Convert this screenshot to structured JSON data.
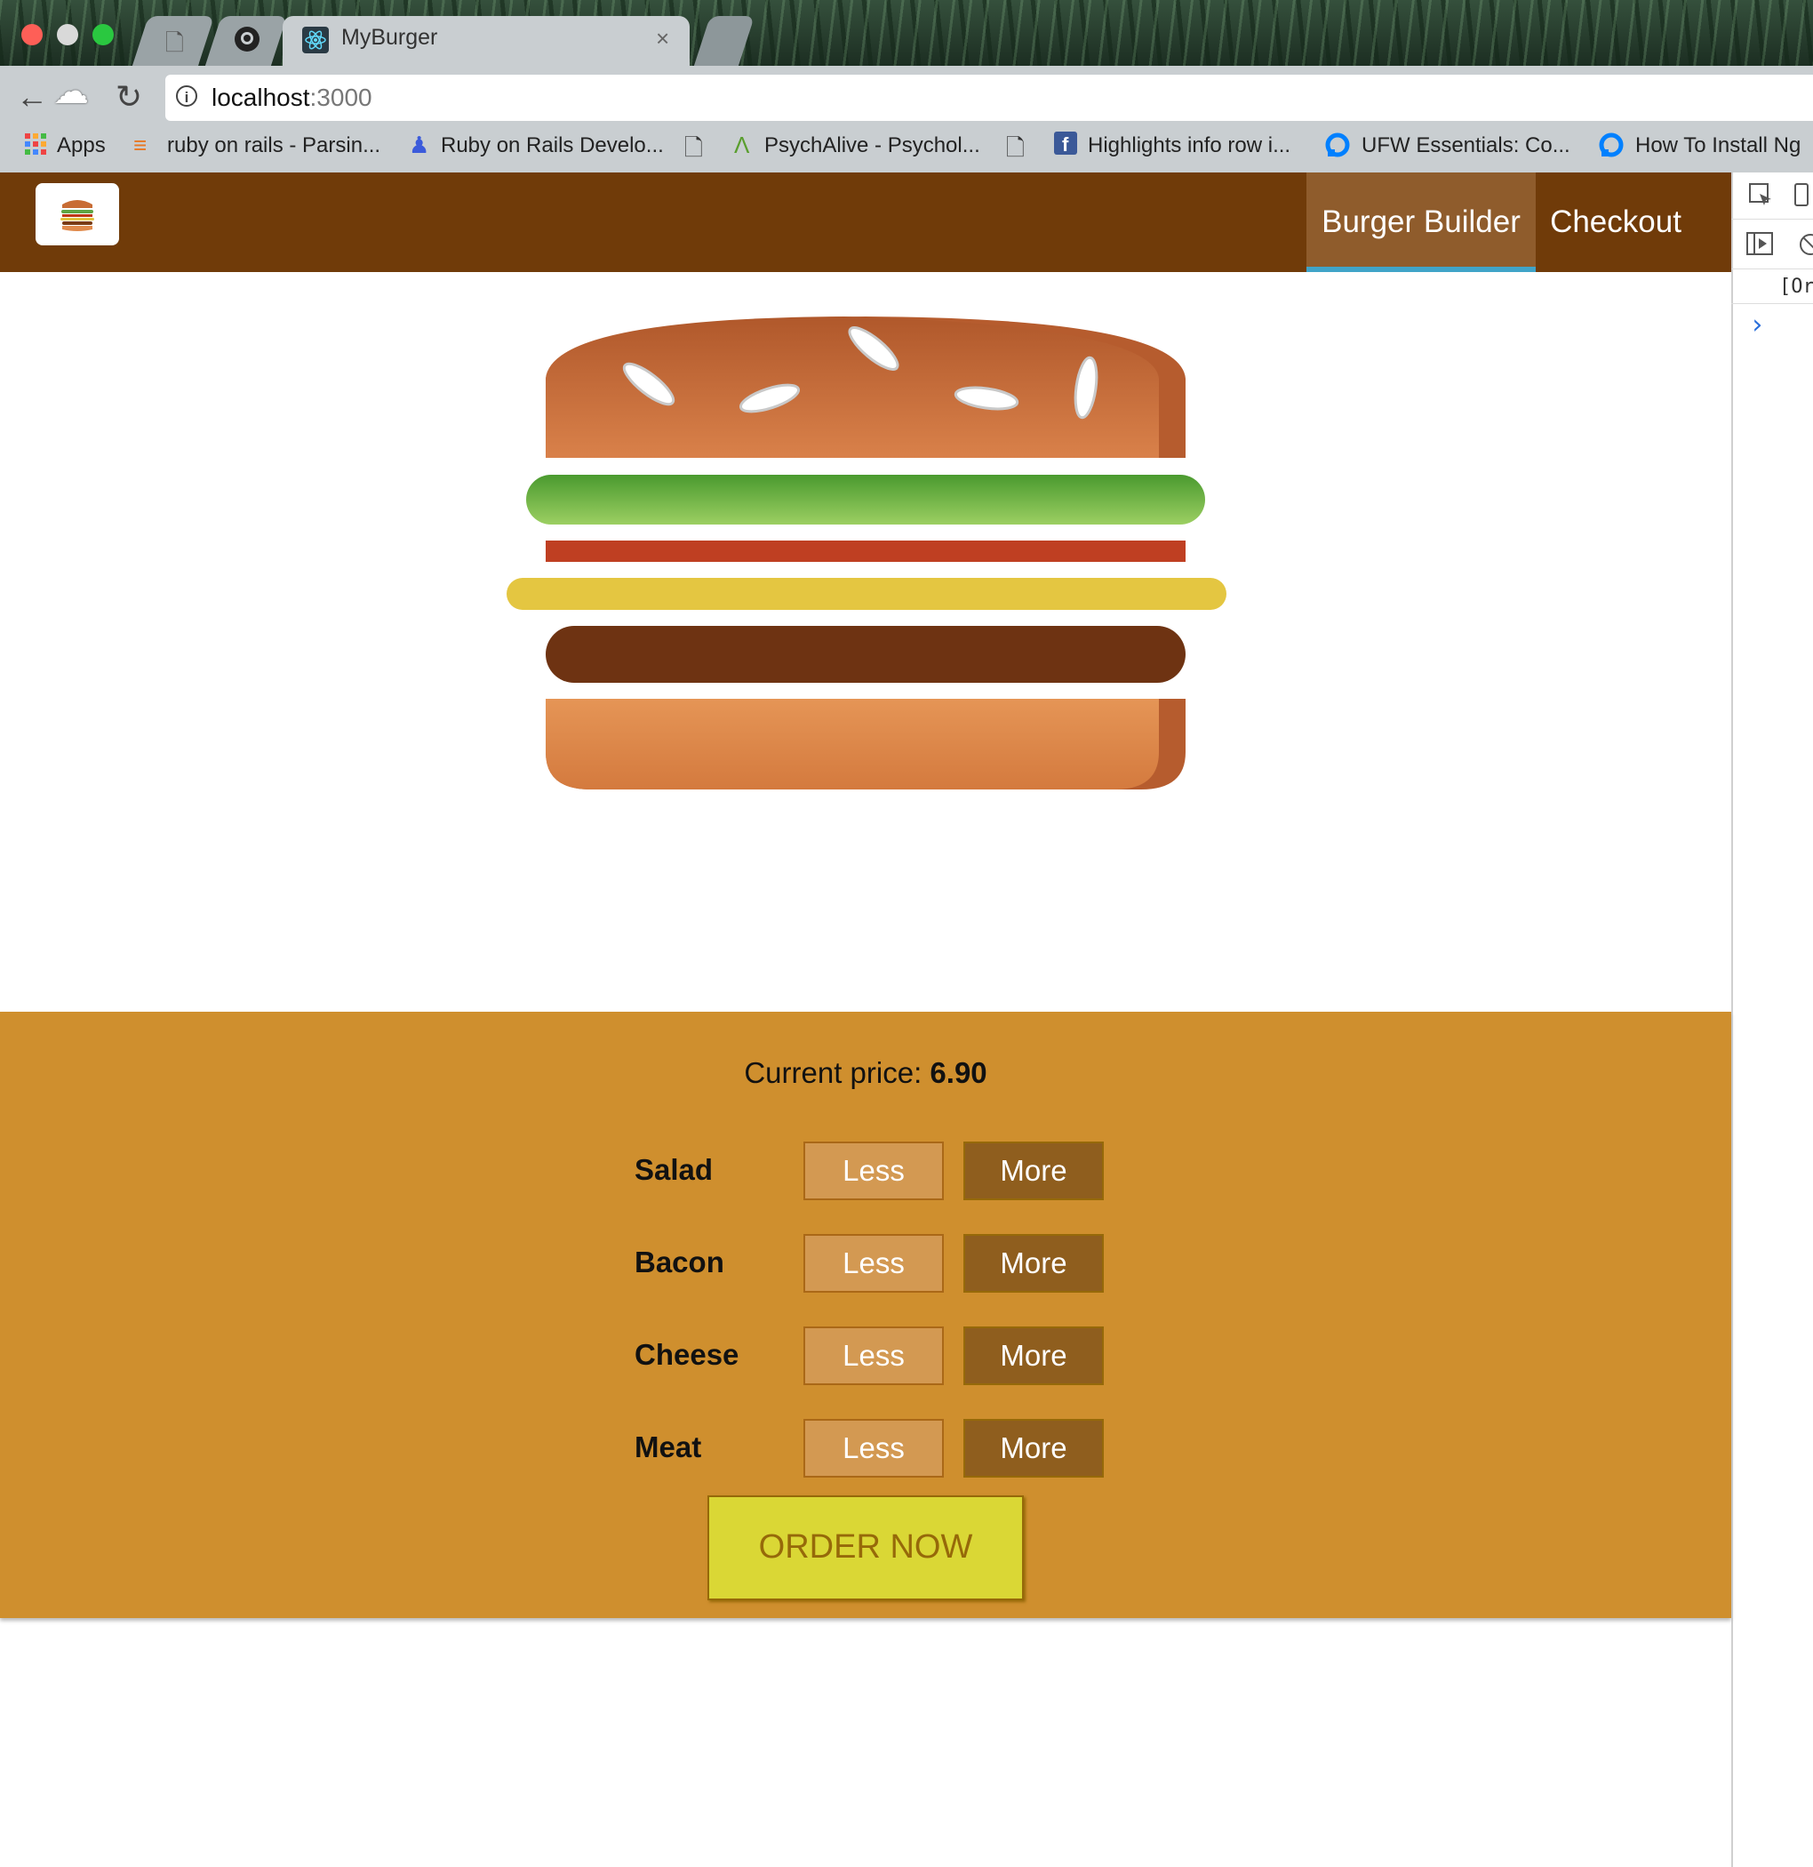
{
  "browser": {
    "tab_title": "MyBurger",
    "tab_close": "×",
    "url_host": "localhost",
    "url_port": ":3000",
    "bookmarks": [
      {
        "label": "Apps",
        "icon": "apps-grid-icon"
      },
      {
        "label": "ruby on rails - Parsin...",
        "icon": "stackoverflow-icon"
      },
      {
        "label": "Ruby on Rails Develo...",
        "icon": "person-icon"
      },
      {
        "label": "",
        "icon": "page-icon"
      },
      {
        "label": "PsychAlive - Psychol...",
        "icon": "psychalive-icon"
      },
      {
        "label": "",
        "icon": "page-icon"
      },
      {
        "label": "Highlights info row i...",
        "icon": "facebook-icon"
      },
      {
        "label": "UFW Essentials: Co...",
        "icon": "digitalocean-icon"
      },
      {
        "label": "How To Install Ng",
        "icon": "digitalocean-icon"
      }
    ]
  },
  "app": {
    "nav": {
      "burger_builder": "Burger Builder",
      "checkout": "Checkout"
    },
    "price_label": "Current price: ",
    "price_value": "6.90",
    "ingredients": [
      {
        "label": "Salad",
        "less": "Less",
        "more": "More"
      },
      {
        "label": "Bacon",
        "less": "Less",
        "more": "More"
      },
      {
        "label": "Cheese",
        "less": "Less",
        "more": "More"
      },
      {
        "label": "Meat",
        "less": "Less",
        "more": "More"
      }
    ],
    "order_button": "ORDER NOW"
  },
  "devtools": {
    "console_line": "[Or",
    "prompt": "›"
  },
  "colors": {
    "header": "#703b09",
    "controls_bg": "#cf8f2e",
    "less_bg": "#d39952",
    "more_bg": "#8f5e1e",
    "order_bg": "#dad735",
    "nav_active_border": "#40a4c8"
  }
}
